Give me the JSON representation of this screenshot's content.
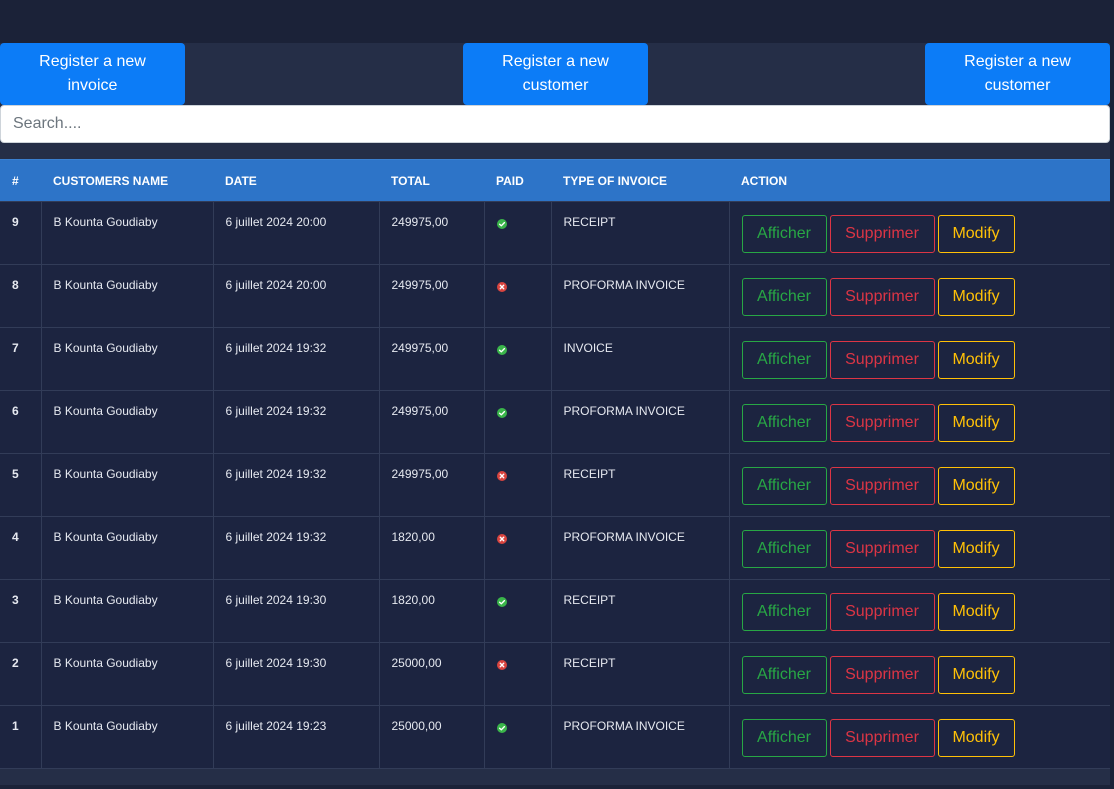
{
  "buttons": {
    "register_invoice": "Register a new invoice",
    "register_customer_1": "Register a new customer",
    "register_customer_2": "Register a new customer"
  },
  "search": {
    "placeholder": "Search...."
  },
  "table": {
    "headers": [
      "#",
      "CUSTOMERS NAME",
      "DATE",
      "TOTAL",
      "PAID",
      "TYPE OF INVOICE",
      "ACTION"
    ],
    "action_labels": {
      "view": "Afficher",
      "delete": "Supprimer",
      "modify": "Modify"
    },
    "rows": [
      {
        "id": "9",
        "customer": "B Kounta Goudiaby",
        "date": "6 juillet 2024 20:00",
        "total": "249975,00",
        "paid": true,
        "type": "RECEIPT"
      },
      {
        "id": "8",
        "customer": "B Kounta Goudiaby",
        "date": "6 juillet 2024 20:00",
        "total": "249975,00",
        "paid": false,
        "type": "PROFORMA INVOICE"
      },
      {
        "id": "7",
        "customer": "B Kounta Goudiaby",
        "date": "6 juillet 2024 19:32",
        "total": "249975,00",
        "paid": true,
        "type": "INVOICE"
      },
      {
        "id": "6",
        "customer": "B Kounta Goudiaby",
        "date": "6 juillet 2024 19:32",
        "total": "249975,00",
        "paid": true,
        "type": "PROFORMA INVOICE"
      },
      {
        "id": "5",
        "customer": "B Kounta Goudiaby",
        "date": "6 juillet 2024 19:32",
        "total": "249975,00",
        "paid": false,
        "type": "RECEIPT"
      },
      {
        "id": "4",
        "customer": "B Kounta Goudiaby",
        "date": "6 juillet 2024 19:32",
        "total": "1820,00",
        "paid": false,
        "type": "PROFORMA INVOICE"
      },
      {
        "id": "3",
        "customer": "B Kounta Goudiaby",
        "date": "6 juillet 2024 19:30",
        "total": "1820,00",
        "paid": true,
        "type": "RECEIPT"
      },
      {
        "id": "2",
        "customer": "B Kounta Goudiaby",
        "date": "6 juillet 2024 19:30",
        "total": "25000,00",
        "paid": false,
        "type": "RECEIPT"
      },
      {
        "id": "1",
        "customer": "B Kounta Goudiaby",
        "date": "6 juillet 2024 19:23",
        "total": "25000,00",
        "paid": true,
        "type": "PROFORMA INVOICE"
      }
    ]
  },
  "icons": {
    "paid_true": "check-circle-icon",
    "paid_false": "x-circle-icon"
  },
  "colors": {
    "primary": "#0c7cf7",
    "header": "#2d74c8",
    "paid": "#3ab54a",
    "unpaid": "#d9443f",
    "view": "#28a745",
    "delete": "#dc3545",
    "modify": "#ffc107"
  }
}
